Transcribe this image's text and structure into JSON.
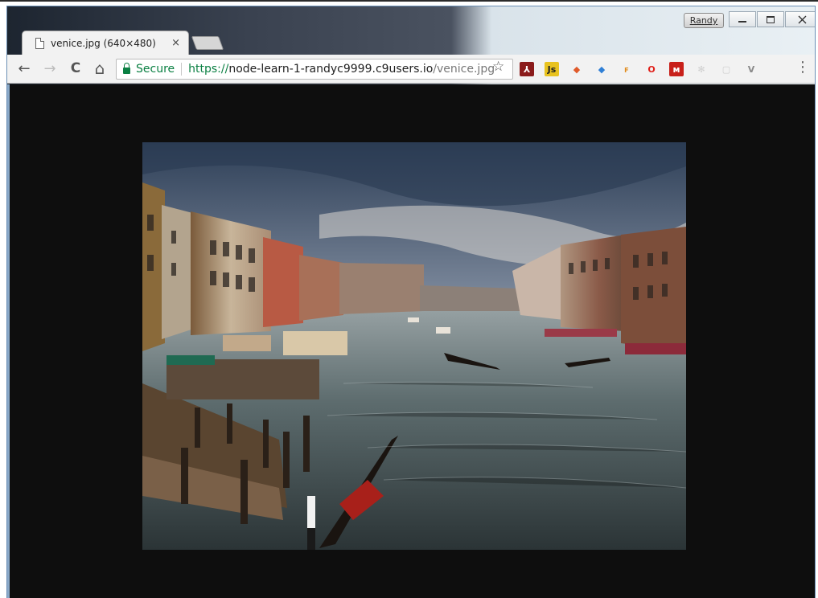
{
  "window": {
    "profile_name": "Randy",
    "controls": [
      "minimize",
      "restore",
      "close"
    ]
  },
  "tab": {
    "title": "venice.jpg (640×480)",
    "close_glyph": "×"
  },
  "toolbar": {
    "back_glyph": "←",
    "forward_glyph": "→",
    "reload_glyph": "C",
    "home_glyph": "⌂",
    "secure_label": "Secure",
    "url_scheme": "https://",
    "url_host": "node-learn-1-randyc9999.c9users.io",
    "url_path": "/venice.jpg",
    "bookmark_glyph": "☆",
    "menu_glyph": "⋮"
  },
  "extensions": [
    {
      "name": "acrobat-icon",
      "glyph": "⅄",
      "bg": "#8b1c1c",
      "fg": "#ffffff"
    },
    {
      "name": "js-icon",
      "glyph": "Js",
      "bg": "#e8c21f",
      "fg": "#222222"
    },
    {
      "name": "color-picker-icon",
      "glyph": "◆",
      "bg": "transparent",
      "fg": "#e05a2a"
    },
    {
      "name": "graduation-cap-icon",
      "glyph": "◆",
      "bg": "transparent",
      "fg": "#2f7fd6"
    },
    {
      "name": "hammer-icon",
      "glyph": "ꜰ",
      "bg": "transparent",
      "fg": "#e08a1a"
    },
    {
      "name": "opera-icon",
      "glyph": "O",
      "bg": "transparent",
      "fg": "#e0201a"
    },
    {
      "name": "mega-icon",
      "glyph": "ᴍ",
      "bg": "#c8201a",
      "fg": "#ffffff"
    },
    {
      "name": "react-icon",
      "glyph": "✻",
      "bg": "transparent",
      "fg": "#cfcfcf"
    },
    {
      "name": "square-ext-icon",
      "glyph": "▢",
      "bg": "transparent",
      "fg": "#cfcfcf"
    },
    {
      "name": "vue-icon",
      "glyph": "V",
      "bg": "transparent",
      "fg": "#8a8a8a"
    }
  ],
  "colors": {
    "viewer_background": "#0e0e0e",
    "secure_green": "#0b8043"
  }
}
